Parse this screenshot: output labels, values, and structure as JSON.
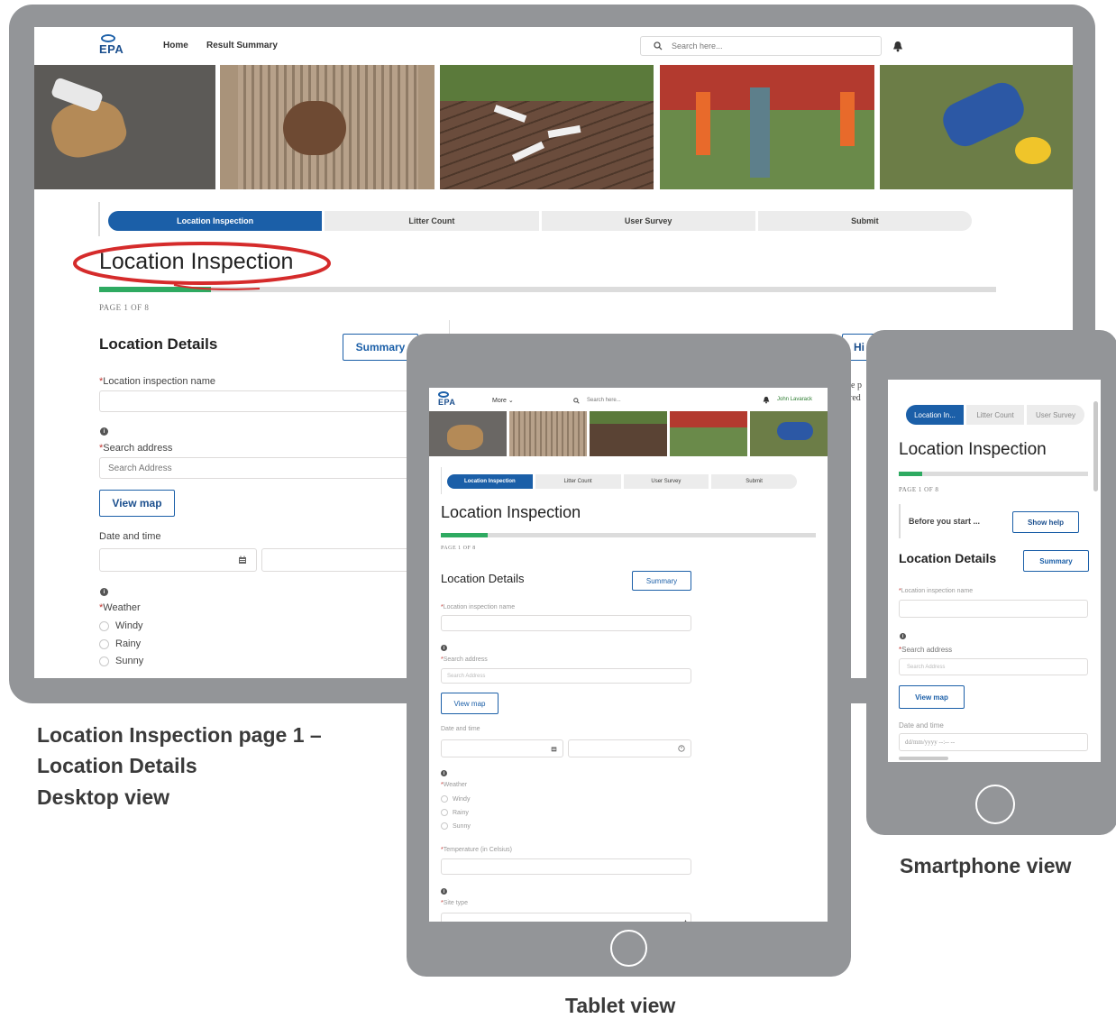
{
  "colors": {
    "device_frame": "#939598",
    "brand_blue": "#1b5fa8",
    "progress_green": "#2eaa61",
    "highlight_red": "#d52b2b"
  },
  "desktop": {
    "logo": "EPA",
    "nav": [
      "Home",
      "Result Summary"
    ],
    "search_placeholder": "Search here...",
    "path_steps": [
      "Location Inspection",
      "Litter Count",
      "User Survey",
      "Submit"
    ],
    "page_title": "Location Inspection",
    "progress_fraction": 0.125,
    "page_count": "PAGE 1 OF 8",
    "section_title": "Location Details",
    "summary_button": "Summary",
    "help_button_partial": "Hi",
    "peek_text": [
      "ve p",
      "red"
    ],
    "field_name_label": "Location inspection name",
    "search_address_label": "Search address",
    "search_address_placeholder": "Search Address",
    "view_map_button": "View map",
    "date_time_label": "Date and time",
    "weather_label": "Weather",
    "weather_options": [
      "Windy",
      "Rainy",
      "Sunny"
    ]
  },
  "tablet": {
    "logo": "EPA",
    "nav_more": "More",
    "search_placeholder": "Search here...",
    "user_name": "John Lavarack",
    "path_steps": [
      "Location Inspection",
      "Litter Count",
      "User Survey",
      "Submit"
    ],
    "page_title": "Location Inspection",
    "progress_fraction": 0.125,
    "page_count": "PAGE 1 OF 8",
    "section_title": "Location Details",
    "summary_button": "Summary",
    "field_name_label": "Location inspection name",
    "search_address_label": "Search address",
    "search_address_placeholder": "Search Address",
    "view_map_button": "View map",
    "date_time_label": "Date and time",
    "weather_label": "Weather",
    "weather_options": [
      "Windy",
      "Rainy",
      "Sunny"
    ],
    "temperature_label": "Temperature (in Celsius)",
    "site_type_label": "Site type"
  },
  "phone": {
    "path_steps": [
      "Location In...",
      "Litter Count",
      "User Survey"
    ],
    "page_title": "Location Inspection",
    "progress_fraction": 0.125,
    "page_count": "PAGE 1 OF 8",
    "before_start": "Before you start ...",
    "show_help_button": "Show help",
    "section_title": "Location Details",
    "summary_button": "Summary",
    "field_name_label": "Location inspection name",
    "search_address_label": "Search address",
    "search_address_placeholder": "Search Address",
    "view_map_button": "View map",
    "date_time_label": "Date and time",
    "date_placeholder": "dd/mm/yyyy --:-- --"
  },
  "captions": {
    "desktop": [
      "Location Inspection page 1 –",
      "Location Details",
      "Desktop view"
    ],
    "tablet": "Tablet view",
    "phone": "Smartphone view"
  }
}
